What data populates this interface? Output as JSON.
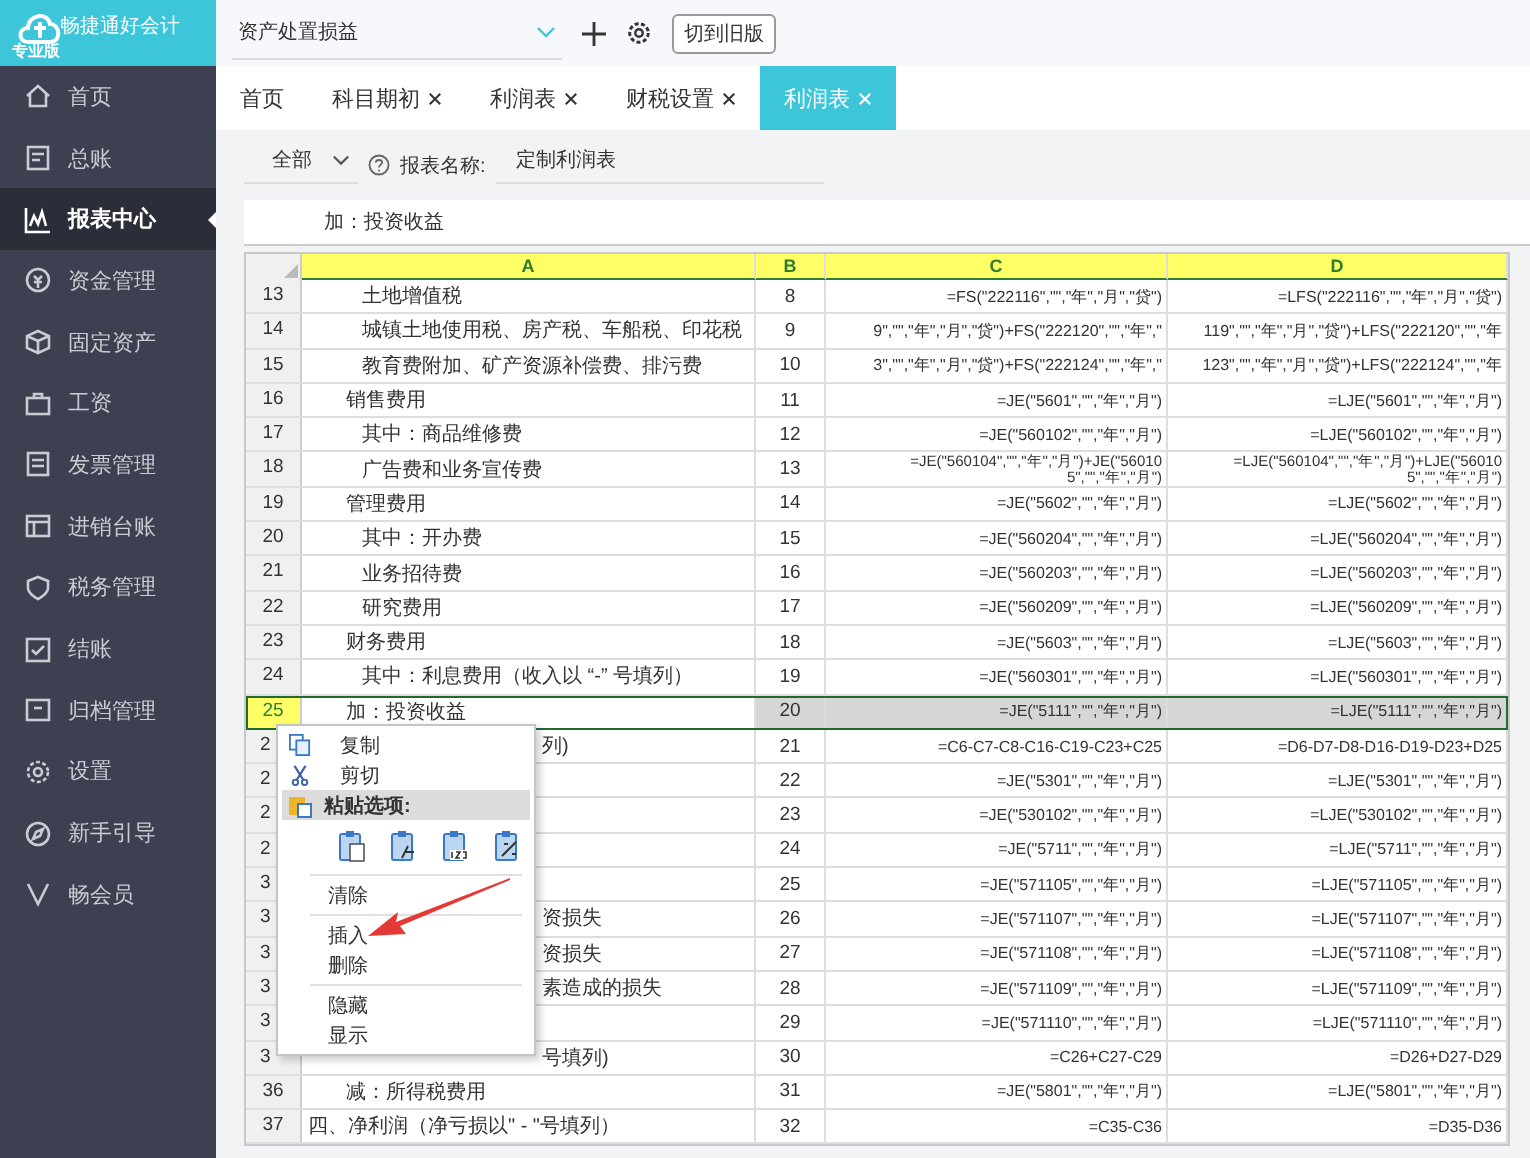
{
  "app": {
    "logo_title": "畅捷通好会计",
    "edition": "专业版"
  },
  "sidebar": {
    "items": [
      {
        "label": "首页",
        "selected": false
      },
      {
        "label": "总账",
        "selected": false
      },
      {
        "label": "报表中心",
        "selected": true
      },
      {
        "label": "资金管理",
        "selected": false
      },
      {
        "label": "固定资产",
        "selected": false
      },
      {
        "label": "工资",
        "selected": false
      },
      {
        "label": "发票管理",
        "selected": false
      },
      {
        "label": "进销台账",
        "selected": false
      },
      {
        "label": "税务管理",
        "selected": false
      },
      {
        "label": "结账",
        "selected": false
      },
      {
        "label": "归档管理",
        "selected": false
      },
      {
        "label": "设置",
        "selected": false
      },
      {
        "label": "新手引导",
        "selected": false
      },
      {
        "label": "畅会员",
        "selected": false
      }
    ]
  },
  "topbar": {
    "report_select": {
      "value": "资产处置损益"
    },
    "switch_button": "切到旧版"
  },
  "tabs": [
    {
      "label": "首页",
      "closable": false,
      "selected": false
    },
    {
      "label": "科目期初",
      "closable": true,
      "selected": false
    },
    {
      "label": "利润表",
      "closable": true,
      "selected": false
    },
    {
      "label": "财税设置",
      "closable": true,
      "selected": false
    },
    {
      "label": "利润表",
      "closable": true,
      "selected": true
    }
  ],
  "toolbar": {
    "filter": {
      "value": "全部"
    },
    "report_name_label": "报表名称:",
    "report_name": "定制利润表"
  },
  "formula_bar": {
    "value": "加：投资收益"
  },
  "sheet": {
    "columns": [
      "A",
      "B",
      "C",
      "D"
    ],
    "rows": [
      {
        "number": "13",
        "kind": "detail",
        "a": "土地增值税",
        "b": "8",
        "c": "=FS(\"222116\",\"\",\"年\",\"月\",\"贷\")",
        "d": "=LFS(\"222116\",\"\",\"年\",\"月\",\"贷\")",
        "selected": false
      },
      {
        "number": "14",
        "kind": "detail",
        "a": "城镇土地使用税、房产税、车船税、印花税",
        "b": "9",
        "c": "9\",\"\",\"年\",\"月\",\"贷\")+FS(\"222120\",\"\",\"年\",\"",
        "d": "119\",\"\",\"年\",\"月\",\"贷\")+LFS(\"222120\",\"\",\"年",
        "selected": false
      },
      {
        "number": "15",
        "kind": "detail",
        "a": "教育费附加、矿产资源补偿费、排污费",
        "b": "10",
        "c": "3\",\"\",\"年\",\"月\",\"贷\")+FS(\"222124\",\"\",\"年\",\"",
        "d": "123\",\"\",\"年\",\"月\",\"贷\")+LFS(\"222124\",\"\",\"年",
        "selected": false
      },
      {
        "number": "16",
        "kind": "group",
        "a": "销售费用",
        "b": "11",
        "c": "=JE(\"5601\",\"\",\"年\",\"月\")",
        "d": "=LJE(\"5601\",\"\",\"年\",\"月\")",
        "selected": false
      },
      {
        "number": "17",
        "kind": "detail",
        "a": "其中：商品维修费",
        "b": "12",
        "c": "=JE(\"560102\",\"\",\"年\",\"月\")",
        "d": "=LJE(\"560102\",\"\",\"年\",\"月\")",
        "selected": false
      },
      {
        "number": "18",
        "kind": "detail",
        "a": "广告费和业务宣传费",
        "b": "13",
        "c": "=JE(\"560104\",\"\",\"年\",\"月\")+JE(\"560105\",\"\",\"年\",\"月\")",
        "d": "=LJE(\"560104\",\"\",\"年\",\"月\")+LJE(\"560105\",\"\",\"年\",\"月\")",
        "selected": false
      },
      {
        "number": "19",
        "kind": "group",
        "a": "管理费用",
        "b": "14",
        "c": "=JE(\"5602\",\"\",\"年\",\"月\")",
        "d": "=LJE(\"5602\",\"\",\"年\",\"月\")",
        "selected": false
      },
      {
        "number": "20",
        "kind": "detail",
        "a": "其中：开办费",
        "b": "15",
        "c": "=JE(\"560204\",\"\",\"年\",\"月\")",
        "d": "=LJE(\"560204\",\"\",\"年\",\"月\")",
        "selected": false
      },
      {
        "number": "21",
        "kind": "detail",
        "a": "业务招待费",
        "b": "16",
        "c": "=JE(\"560203\",\"\",\"年\",\"月\")",
        "d": "=LJE(\"560203\",\"\",\"年\",\"月\")",
        "selected": false
      },
      {
        "number": "22",
        "kind": "detail",
        "a": "研究费用",
        "b": "17",
        "c": "=JE(\"560209\",\"\",\"年\",\"月\")",
        "d": "=LJE(\"560209\",\"\",\"年\",\"月\")",
        "selected": false
      },
      {
        "number": "23",
        "kind": "group",
        "a": "财务费用",
        "b": "18",
        "c": "=JE(\"5603\",\"\",\"年\",\"月\")",
        "d": "=LJE(\"5603\",\"\",\"年\",\"月\")",
        "selected": false
      },
      {
        "number": "24",
        "kind": "detail",
        "a": "其中：利息费用（收入以 “-” 号填列）",
        "b": "19",
        "c": "=JE(\"560301\",\"\",\"年\",\"月\")",
        "d": "=LJE(\"560301\",\"\",\"年\",\"月\")",
        "selected": false
      },
      {
        "number": "25",
        "kind": "group",
        "a": "加：投资收益",
        "b": "20",
        "c": "=JE(\"5111\",\"\",\"年\",\"月\")",
        "d": "=LJE(\"5111\",\"\",\"年\",\"月\")",
        "selected": true
      },
      {
        "number": "2",
        "kind": "covered",
        "a": "列)",
        "b": "21",
        "c": "=C6-C7-C8-C16-C19-C23+C25",
        "d": "=D6-D7-D8-D16-D19-D23+D25",
        "selected": false
      },
      {
        "number": "2",
        "kind": "covered",
        "b": "22",
        "c": "=JE(\"5301\",\"\",\"年\",\"月\")",
        "d": "=LJE(\"5301\",\"\",\"年\",\"月\")",
        "selected": false
      },
      {
        "number": "2",
        "kind": "covered",
        "b": "23",
        "c": "=JE(\"530102\",\"\",\"年\",\"月\")",
        "d": "=LJE(\"530102\",\"\",\"年\",\"月\")",
        "selected": false
      },
      {
        "number": "2",
        "kind": "covered",
        "b": "24",
        "c": "=JE(\"5711\",\"\",\"年\",\"月\")",
        "d": "=LJE(\"5711\",\"\",\"年\",\"月\")",
        "selected": false
      },
      {
        "number": "3",
        "kind": "covered",
        "b": "25",
        "c": "=JE(\"571105\",\"\",\"年\",\"月\")",
        "d": "=LJE(\"571105\",\"\",\"年\",\"月\")",
        "selected": false
      },
      {
        "number": "3",
        "kind": "covered",
        "a": "资损失",
        "b": "26",
        "c": "=JE(\"571107\",\"\",\"年\",\"月\")",
        "d": "=LJE(\"571107\",\"\",\"年\",\"月\")",
        "selected": false
      },
      {
        "number": "3",
        "kind": "covered",
        "a": "资损失",
        "b": "27",
        "c": "=JE(\"571108\",\"\",\"年\",\"月\")",
        "d": "=LJE(\"571108\",\"\",\"年\",\"月\")",
        "selected": false
      },
      {
        "number": "3",
        "kind": "covered",
        "a": "素造成的损失",
        "b": "28",
        "c": "=JE(\"571109\",\"\",\"年\",\"月\")",
        "d": "=LJE(\"571109\",\"\",\"年\",\"月\")",
        "selected": false
      },
      {
        "number": "3",
        "kind": "covered",
        "b": "29",
        "c": "=JE(\"571110\",\"\",\"年\",\"月\")",
        "d": "=LJE(\"571110\",\"\",\"年\",\"月\")",
        "selected": false
      },
      {
        "number": "3",
        "kind": "covered",
        "a": "号填列)",
        "b": "30",
        "c": "=C26+C27-C29",
        "d": "=D26+D27-D29",
        "selected": false
      },
      {
        "number": "36",
        "kind": "group",
        "a": "减：所得税费用",
        "b": "31",
        "c": "=JE(\"5801\",\"\",\"年\",\"月\")",
        "d": "=LJE(\"5801\",\"\",\"年\",\"月\")",
        "selected": false
      },
      {
        "number": "37",
        "kind": "total",
        "a": "四、净利润（净亏损以\" - \"号填列）",
        "b": "32",
        "c": "=C35-C36",
        "d": "=D35-D36",
        "selected": false
      }
    ]
  },
  "context_menu": {
    "items": [
      {
        "kind": "command",
        "label": "复制"
      },
      {
        "kind": "command",
        "label": "剪切"
      },
      {
        "kind": "header",
        "label": "粘贴选项:"
      },
      {
        "kind": "paste_icons"
      },
      {
        "kind": "separator"
      },
      {
        "kind": "command",
        "label": "清除"
      },
      {
        "kind": "separator"
      },
      {
        "kind": "command",
        "label": "插入"
      },
      {
        "kind": "command",
        "label": "删除"
      },
      {
        "kind": "separator"
      },
      {
        "kind": "command",
        "label": "隐藏"
      },
      {
        "kind": "command",
        "label": "显示"
      }
    ]
  }
}
